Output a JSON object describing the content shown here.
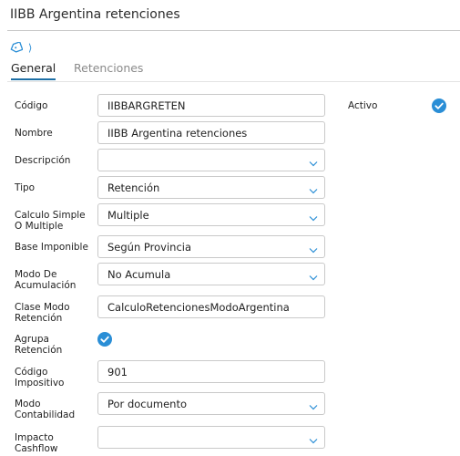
{
  "title": "IIBB Argentina retenciones",
  "breadcrumb": {
    "tag_icon": "tag-icon",
    "chevron": "⟩"
  },
  "tabs": [
    {
      "label": "General",
      "active": true
    },
    {
      "label": "Retenciones",
      "active": false
    }
  ],
  "form": {
    "codigo": {
      "label": "Código",
      "value": "IIBBARGRETEN"
    },
    "nombre": {
      "label": "Nombre",
      "value": "IIBB Argentina retenciones"
    },
    "descripcion": {
      "label": "Descripción",
      "value": ""
    },
    "tipo": {
      "label": "Tipo",
      "value": "Retención"
    },
    "calculo": {
      "label_l1": "Calculo Simple",
      "label_l2": "O Multiple",
      "value": "Multiple"
    },
    "base": {
      "label": "Base Imponible",
      "value": "Según Provincia"
    },
    "modo_acum": {
      "label_l1": "Modo De",
      "label_l2": "Acumulación",
      "value": "No Acumula"
    },
    "clase_modo": {
      "label_l1": "Clase Modo",
      "label_l2": "Retención",
      "value": "CalculoRetencionesModoArgentina"
    },
    "agrupa": {
      "label_l1": "Agrupa",
      "label_l2": "Retención",
      "checked": true
    },
    "codigo_imp": {
      "label_l1": "Código",
      "label_l2": "Impositivo",
      "value": "901"
    },
    "modo_cont": {
      "label_l1": "Modo",
      "label_l2": "Contabilidad",
      "value": "Por documento"
    },
    "impacto": {
      "label_l1": "Impacto",
      "label_l2": "Cashflow",
      "value": ""
    },
    "activo": {
      "label": "Activo",
      "checked": true
    }
  },
  "colors": {
    "accent": "#1d6fa5",
    "check": "#2a8ed6",
    "border": "#c9c9c9"
  }
}
